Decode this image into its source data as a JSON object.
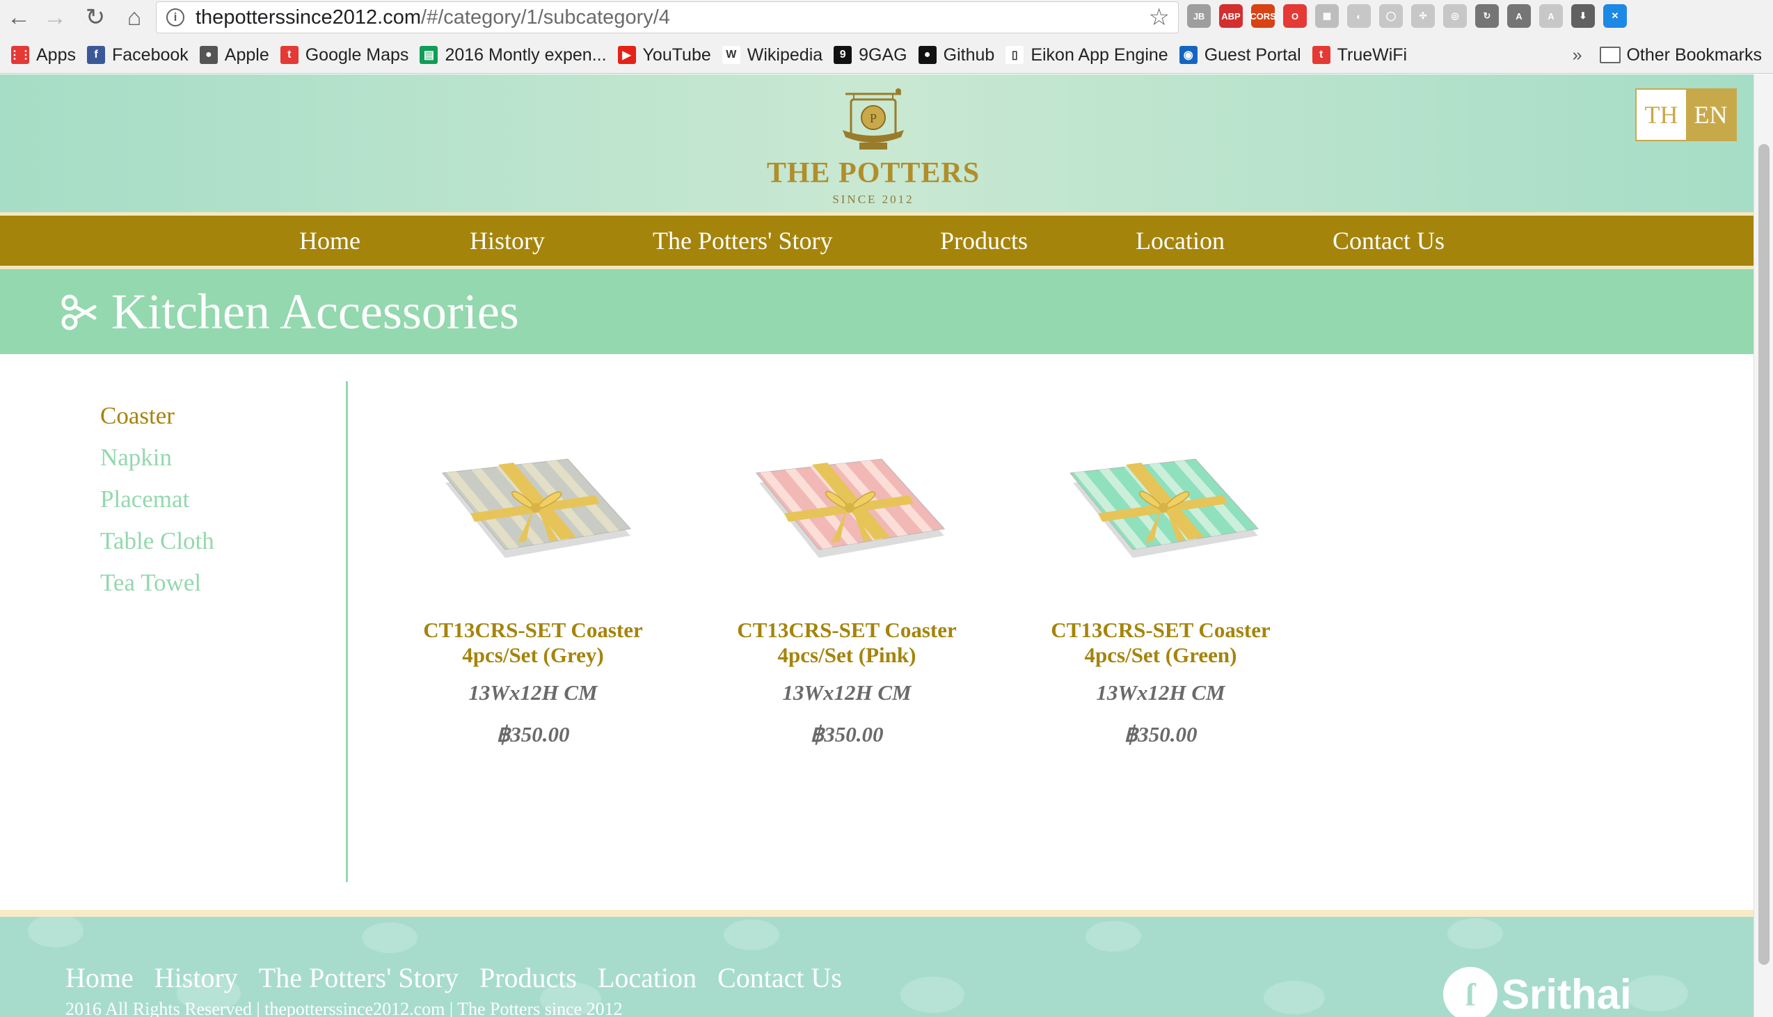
{
  "browser": {
    "url_host": "thepotterssince2012.com",
    "url_path": "/#/category/1/subcategory/4",
    "back_icon": "←",
    "forward_icon": "→",
    "reload_icon": "↻",
    "home_icon": "⌂",
    "star_icon": "☆",
    "info_icon": "i",
    "extensions": [
      {
        "name": "jb-icon",
        "label": "JB",
        "color": "#9e9e9e"
      },
      {
        "name": "adblock-icon",
        "label": "ABP",
        "color": "#d32f2f"
      },
      {
        "name": "cors-icon",
        "label": "CORS",
        "color": "#d84315"
      },
      {
        "name": "opera-icon",
        "label": "O",
        "color": "#e53935"
      },
      {
        "name": "page-icon",
        "label": "▦",
        "color": "#bdbdbd"
      },
      {
        "name": "ext-icon-6",
        "label": "◐",
        "color": "#c7c7c7"
      },
      {
        "name": "ext-icon-7",
        "label": "◯",
        "color": "#c7c7c7"
      },
      {
        "name": "ext-icon-8",
        "label": "✣",
        "color": "#c7c7c7"
      },
      {
        "name": "ext-icon-9",
        "label": "◎",
        "color": "#c7c7c7"
      },
      {
        "name": "ext-icon-10",
        "label": "↻",
        "color": "#757575"
      },
      {
        "name": "angular-icon",
        "label": "A",
        "color": "#757575"
      },
      {
        "name": "angular-grey-icon",
        "label": "A",
        "color": "#c7c7c7"
      },
      {
        "name": "download-icon",
        "label": "⬇",
        "color": "#616161"
      },
      {
        "name": "blue-ext-icon",
        "label": "✕",
        "color": "#1e88e5"
      }
    ],
    "bookmarks": [
      {
        "name": "bookmark-apps",
        "icon": "apps-grid-icon",
        "glyph": "⋮⋮",
        "color": "#e53935",
        "label": "Apps"
      },
      {
        "name": "bookmark-facebook",
        "icon": "facebook-icon",
        "glyph": "f",
        "color": "#3b5998",
        "label": "Facebook"
      },
      {
        "name": "bookmark-apple",
        "icon": "apple-icon",
        "glyph": "●",
        "color": "#555555",
        "label": "Apple"
      },
      {
        "name": "bookmark-google-maps",
        "icon": "true-logo-icon",
        "glyph": "t",
        "color": "#e53935",
        "label": "Google Maps"
      },
      {
        "name": "bookmark-expense",
        "icon": "sheets-icon",
        "glyph": "▤",
        "color": "#0f9d58",
        "label": "2016 Montly expen..."
      },
      {
        "name": "bookmark-youtube",
        "icon": "youtube-icon",
        "glyph": "▶",
        "color": "#e62117",
        "label": "YouTube"
      },
      {
        "name": "bookmark-wikipedia",
        "icon": "wikipedia-icon",
        "glyph": "W",
        "color": "#ffffff",
        "label": "Wikipedia"
      },
      {
        "name": "bookmark-9gag",
        "icon": "9gag-icon",
        "glyph": "9",
        "color": "#111111",
        "label": "9GAG"
      },
      {
        "name": "bookmark-github",
        "icon": "github-icon",
        "glyph": "●",
        "color": "#111111",
        "label": "Github"
      },
      {
        "name": "bookmark-eikon",
        "icon": "document-icon",
        "glyph": "▯",
        "color": "#ffffff",
        "label": "Eikon App Engine"
      },
      {
        "name": "bookmark-guest-portal",
        "icon": "globe-icon",
        "glyph": "◉",
        "color": "#1565c0",
        "label": "Guest Portal"
      },
      {
        "name": "bookmark-truewifi",
        "icon": "true-logo-icon",
        "glyph": "t",
        "color": "#e53935",
        "label": "TrueWiFi"
      }
    ],
    "bookmarks_overflow": "»",
    "other_bookmarks": "Other Bookmarks"
  },
  "site": {
    "logo_title": "THE POTTERS",
    "logo_sub": "SINCE 2012",
    "lang_th": "TH",
    "lang_en": "EN",
    "nav": [
      "Home",
      "History",
      "The Potters' Story",
      "Products",
      "Location",
      "Contact Us"
    ],
    "category_title": "Kitchen Accessories",
    "subcategories": [
      {
        "label": "Coaster",
        "active": true
      },
      {
        "label": "Napkin",
        "active": false
      },
      {
        "label": "Placemat",
        "active": false
      },
      {
        "label": "Table Cloth",
        "active": false
      },
      {
        "label": "Tea Towel",
        "active": false
      }
    ],
    "products": [
      {
        "name_line1": "CT13CRS-SET Coaster",
        "name_line2": "4pcs/Set (Grey)",
        "size": "13Wx12H CM",
        "price": "฿350.00",
        "fabric_color": "#c9ccc4",
        "stripe_color": "#e8e2c8"
      },
      {
        "name_line1": "CT13CRS-SET Coaster",
        "name_line2": "4pcs/Set (Pink)",
        "size": "13Wx12H CM",
        "price": "฿350.00",
        "fabric_color": "#f1b8b6",
        "stripe_color": "#fbe4dd"
      },
      {
        "name_line1": "CT13CRS-SET Coaster",
        "name_line2": "4pcs/Set (Green)",
        "size": "13Wx12H CM",
        "price": "฿350.00",
        "fabric_color": "#8fe0bd",
        "stripe_color": "#d7f1e0"
      }
    ],
    "footer_nav": [
      "Home",
      "History",
      "The Potters' Story",
      "Products",
      "Location",
      "Contact Us"
    ],
    "copyright": "2016 All Rights Reserved | thepotterssince2012.com | The Potters since 2012",
    "srithai": "Srithai",
    "colors": {
      "gold": "#a5840b",
      "mint": "#93d8ae",
      "footer": "#a7dccd"
    }
  }
}
